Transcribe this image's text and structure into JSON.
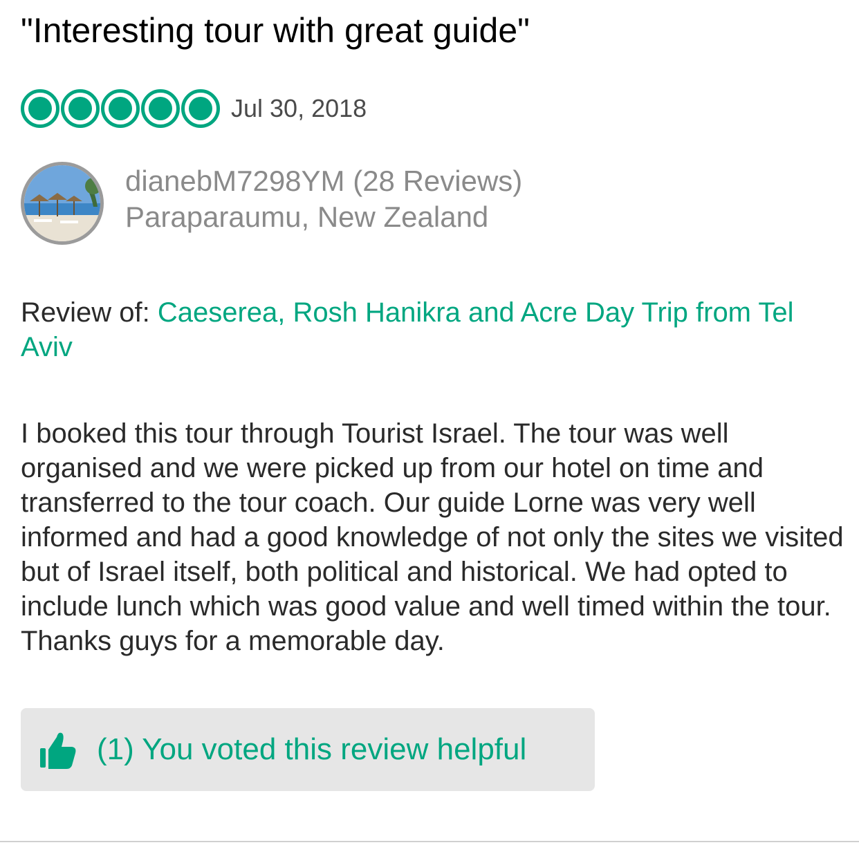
{
  "review": {
    "title": "\"Interesting tour with great guide\"",
    "rating": 5,
    "rating_max": 5,
    "date": "Jul 30, 2018",
    "reviewer": {
      "name_line": "dianebM7298YM (28 Reviews)",
      "location": "Paraparaumu, New Zealand",
      "avatar_icon": "beach-photo-avatar"
    },
    "review_of_label": "Review of: ",
    "review_of_link": "Caeserea, Rosh Hanikra and Acre Day Trip from Tel Aviv",
    "body": "I booked this tour through Tourist Israel.  The tour was well organised and we were picked up from our hotel on time and transferred to the tour coach.  Our guide Lorne was very well informed and had a good knowledge of not only the sites we visited but of Israel itself, both political and historical.  We had opted to include lunch which was good value and well timed within the tour.  Thanks guys for a memorable day.",
    "helpful": {
      "icon": "thumbs-up-icon",
      "label": "(1) You voted this review helpful"
    }
  },
  "colors": {
    "accent": "#00a680",
    "muted_text": "#8a8a8a",
    "button_bg": "#e6e6e6"
  }
}
